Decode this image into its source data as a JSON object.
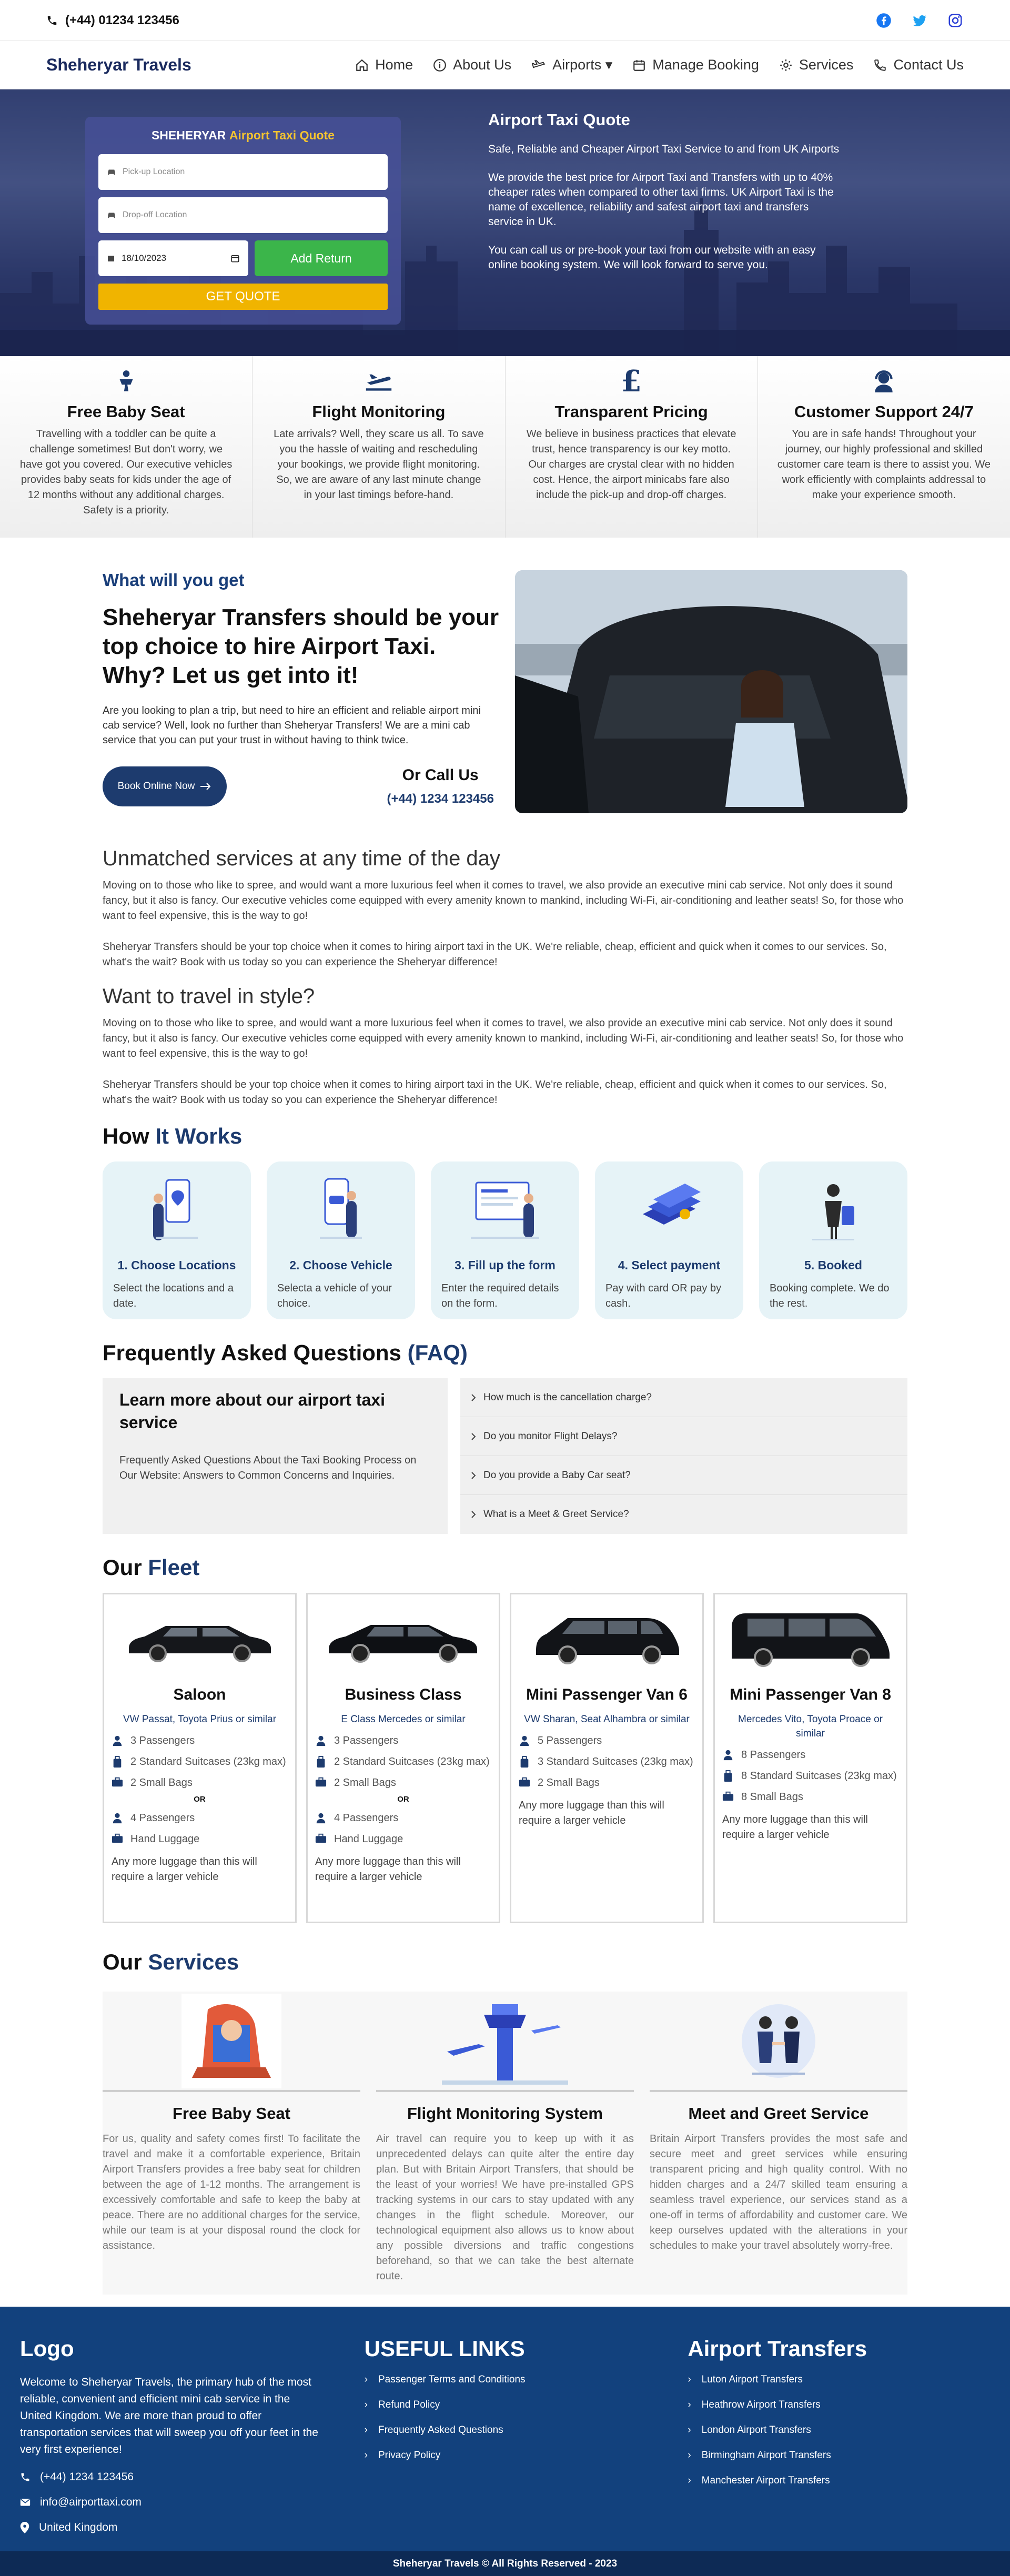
{
  "topbar": {
    "phone": "(+44) 01234 123456"
  },
  "nav": {
    "brand": "Sheheryar Travels",
    "items": [
      {
        "label": "Home"
      },
      {
        "label": "About Us"
      },
      {
        "label": "Airports ▾"
      },
      {
        "label": "Manage Booking"
      },
      {
        "label": "Services"
      },
      {
        "label": "Contact Us"
      }
    ]
  },
  "quote": {
    "title_a": "SHEHERYAR",
    "title_b": "Airport Taxi Quote",
    "pickup_placeholder": "Pick-up Location",
    "dropoff_placeholder": "Drop-off Location",
    "date": "18/10/2023",
    "add_return": "Add Return",
    "get_quote": "GET QUOTE"
  },
  "hero": {
    "title": "Airport Taxi Quote",
    "p1": "Safe, Reliable and Cheaper Airport Taxi Service to and from UK Airports",
    "p2": "We provide the best price for Airport Taxi and Transfers with up to 40% cheaper rates when compared to other taxi firms. UK Airport Taxi is the name of excellence, reliability and safest airport taxi and transfers service in UK.",
    "p3": "You can call us or pre-book your taxi from our website with an easy online booking system. We will look forward to serve you."
  },
  "features": [
    {
      "icon": "baby-icon",
      "title": "Free Baby Seat",
      "text": "Travelling with a toddler can be quite a challenge sometimes! But don't worry, we have got you covered. Our executive vehicles provides baby seats for kids under the age of 12 months without any additional charges. Safety is a priority."
    },
    {
      "icon": "plane-icon",
      "title": "Flight Monitoring",
      "text": "Late arrivals? Well, they scare us all. To save you the hassle of waiting and rescheduling your bookings, we provide flight monitoring. So, we are aware of any last minute change in your last timings before-hand."
    },
    {
      "icon": "pound-icon",
      "title": "Transparent Pricing",
      "text": "We believe in business practices that elevate trust, hence transparency is our key motto. Our charges are crystal clear with no hidden cost. Hence, the airport minicabs fare also include the pick-up and drop-off charges."
    },
    {
      "icon": "headset-icon",
      "title": "Customer Support 24/7",
      "text": "You are in safe hands! Throughout your journey, our highly professional and skilled customer care team is there to assist you. We work efficiently with complaints addressal to make your experience smooth."
    }
  ],
  "why": {
    "eyebrow": "What will you get",
    "title": "Sheheryar Transfers should be your top choice to hire Airport Taxi. Why? Let us get into it!",
    "text": "Are you looking to plan a trip, but need to hire an efficient and reliable airport mini cab service? Well, look no further than Sheheryar Transfers! We are a mini cab service that you can put your trust in without having to think twice.",
    "book": "Book Online Now",
    "call_title": "Or Call Us",
    "call_number": "(+44) 1234 123456"
  },
  "blocks": [
    {
      "title": "Unmatched services at any time of the day",
      "p1": "Moving on to those who like to spree, and would want a more luxurious feel when it comes to travel, we also provide an executive mini cab service. Not only does it sound fancy, but it also is fancy. Our executive vehicles come equipped with every amenity known to mankind, including Wi-Fi, air-conditioning and leather seats! So, for those who want to feel expensive, this is the way to go!",
      "p2": "Sheheryar Transfers should be your top choice when it comes to hiring airport taxi in the UK. We're reliable, cheap, efficient and quick when it comes to our services. So, what's the wait? Book with us today so you can experience the Sheheryar difference!"
    },
    {
      "title": "Want to travel in style?",
      "p1": "Moving on to those who like to spree, and would want a more luxurious feel when it comes to travel, we also provide an executive mini cab service. Not only does it sound fancy, but it also is fancy. Our executive vehicles come equipped with every amenity known to mankind, including Wi-Fi, air-conditioning and leather seats! So, for those who want to feel expensive, this is the way to go!",
      "p2": "Sheheryar Transfers should be your top choice when it comes to hiring airport taxi in the UK. We're reliable, cheap, efficient and quick when it comes to our services. So, what's the wait? Book with us today so you can experience the Sheheryar difference!"
    }
  ],
  "how": {
    "title_a": "How",
    "title_b": "It Works",
    "steps": [
      {
        "title": "1. Choose Locations",
        "text": "Select the locations and a date."
      },
      {
        "title": "2. Choose Vehicle",
        "text": "Selecta a vehicle of your choice."
      },
      {
        "title": "3. Fill up the form",
        "text": "Enter the required details on the form."
      },
      {
        "title": "4. Select payment",
        "text": "Pay with card OR pay by cash."
      },
      {
        "title": "5. Booked",
        "text": "Booking complete. We do the rest."
      }
    ]
  },
  "faq": {
    "title_a": "Frequently Asked Questions",
    "title_b": "(FAQ)",
    "left_title": "Learn more about our airport taxi service",
    "left_text": "Frequently Asked Questions About the Taxi Booking Process on Our Website: Answers to Common Concerns and Inquiries.",
    "questions": [
      "How much is the cancellation charge?",
      "Do you monitor Flight Delays?",
      "Do you provide a Baby Car seat?",
      "What is a Meet & Greet Service?"
    ]
  },
  "fleet": {
    "title_a": "Our",
    "title_b": "Fleet",
    "or_label": "OR",
    "more": "Any more luggage than this will require a larger vehicle",
    "cars": [
      {
        "name": "Saloon",
        "models": "VW Passat, Toyota Prius or similar",
        "passengers": "3 Passengers",
        "suitcases": "2 Standard Suitcases (23kg max)",
        "bags": "2 Small Bags",
        "alt_passengers": "4 Passengers",
        "alt_luggage": "Hand Luggage"
      },
      {
        "name": "Business Class",
        "models": "E Class Mercedes or similar",
        "passengers": "3 Passengers",
        "suitcases": "2 Standard Suitcases (23kg max)",
        "bags": "2 Small Bags",
        "alt_passengers": "4 Passengers",
        "alt_luggage": "Hand Luggage"
      },
      {
        "name": "Mini Passenger Van 6",
        "models": "VW Sharan, Seat Alhambra or similar",
        "passengers": "5 Passengers",
        "suitcases": "3 Standard Suitcases (23kg max)",
        "bags": "2 Small Bags"
      },
      {
        "name": "Mini Passenger Van 8",
        "models": "Mercedes Vito, Toyota Proace or similar",
        "passengers": "8 Passengers",
        "suitcases": "8 Standard Suitcases (23kg max)",
        "bags": "8 Small Bags"
      }
    ]
  },
  "services": {
    "title_a": "Our",
    "title_b": "Services",
    "items": [
      {
        "title": "Free Baby Seat",
        "text": "For us, quality and safety comes first! To facilitate the travel and make it a comfortable experience, Britain Airport Transfers provides a free baby seat for children between the age of 1-12 months. The arrangement is excessively comfortable and safe to keep the baby at peace. There are no additional charges for the service, while our team is at your disposal round the clock for assistance."
      },
      {
        "title": "Flight Monitoring System",
        "text": "Air travel can require you to keep up with it as unprecedented delays can quite alter the entire day plan. But with Britain Airport Transfers, that should be the least of your worries! We have pre-installed GPS tracking systems in our cars to stay updated with any changes in the flight schedule. Moreover, our technological equipment also allows us to know about any possible diversions and traffic congestions beforehand, so that we can take the best alternate route."
      },
      {
        "title": "Meet and Greet Service",
        "text": "Britain Airport Transfers provides the most safe and secure meet and greet services while ensuring transparent pricing and high quality control. With no hidden charges and a 24/7 skilled team ensuring a seamless travel experience, our services stand as a one-off in terms of affordability and customer care. We keep ourselves updated with the alterations in your schedules to make your travel absolutely worry-free."
      }
    ]
  },
  "footer": {
    "logo": "Logo",
    "about": "Welcome to Sheheryar Travels, the primary hub of the most reliable, convenient and efficient mini cab service in the United Kingdom. We are more than proud to offer transportation services that will sweep you off your feet in the very first experience!",
    "phone": "(+44) 1234 123456",
    "email": "info@airporttaxi.com",
    "location": "United Kingdom",
    "links_title": "USEFUL LINKS",
    "links": [
      "Passenger Terms and Conditions",
      "Refund Policy",
      "Frequently Asked Questions",
      "Privacy Policy"
    ],
    "transfers_title": "Airport Transfers",
    "transfers": [
      "Luton Airport Transfers",
      "Heathrow Airport Transfers",
      "London Airport Transfers",
      "Birmingham Airport Transfers",
      "Manchester Airport Transfers"
    ],
    "copyright": "Sheheryar Travels © All Rights Reserved - 2023"
  },
  "colors": {
    "brand_navy": "#1d3b6e",
    "footer_blue": "#12417d",
    "accent_green": "#3bb54a",
    "accent_yellow": "#f0b400"
  }
}
